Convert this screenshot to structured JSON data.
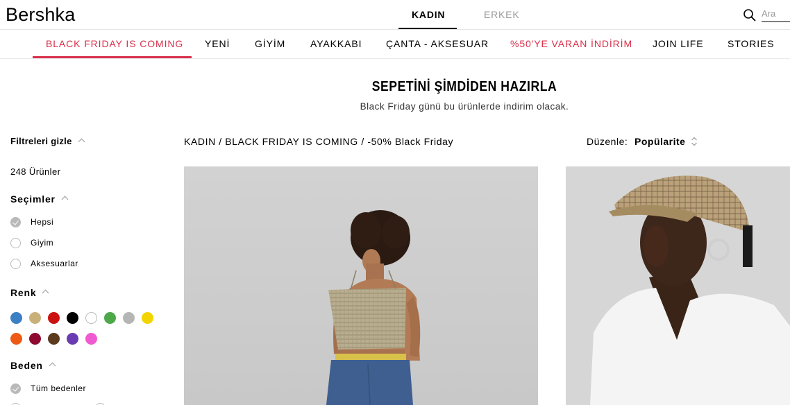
{
  "header": {
    "logo": "Bershka",
    "gender_tabs": [
      {
        "label": "KADIN",
        "active": true
      },
      {
        "label": "ERKEK",
        "active": false
      }
    ],
    "search": {
      "placeholder": "Ara",
      "icon": "search-icon"
    }
  },
  "nav": {
    "items": [
      {
        "label": "BLACK FRIDAY IS COMING",
        "highlight": true,
        "active": true
      },
      {
        "label": "YENİ"
      },
      {
        "label": "GİYİM"
      },
      {
        "label": "AYAKKABI"
      },
      {
        "label": "ÇANTA - AKSESUAR"
      },
      {
        "label": "%50'YE VARAN İNDİRİM",
        "highlight": true
      },
      {
        "label": "JOIN LIFE"
      },
      {
        "label": "STORIES"
      }
    ],
    "highlight_color": "#d9304a"
  },
  "hero": {
    "title": "SEPETİNİ ŞİMDİDEN HAZIRLA",
    "subtitle": "Black Friday günü bu ürünlerde indirim olacak."
  },
  "sidebar": {
    "filter_toggle": "Filtreleri gizle",
    "product_count": "248 Ürünler",
    "selections": {
      "title": "Seçimler",
      "options": [
        {
          "label": "Hepsi",
          "checked": true
        },
        {
          "label": "Giyim",
          "checked": false
        },
        {
          "label": "Aksesuarlar",
          "checked": false
        }
      ]
    },
    "color": {
      "title": "Renk",
      "swatches": [
        {
          "name": "blue",
          "hex": "#3b7fc4"
        },
        {
          "name": "beige",
          "hex": "#c9b07a"
        },
        {
          "name": "red",
          "hex": "#cc1111"
        },
        {
          "name": "black",
          "hex": "#000000"
        },
        {
          "name": "white",
          "hex": "#ffffff"
        },
        {
          "name": "green",
          "hex": "#4da84a"
        },
        {
          "name": "grey",
          "hex": "#b5b5b5"
        },
        {
          "name": "yellow",
          "hex": "#f2d500"
        },
        {
          "name": "orange",
          "hex": "#ee5a14"
        },
        {
          "name": "burgundy",
          "hex": "#8e0a30"
        },
        {
          "name": "brown",
          "hex": "#5c3a1e"
        },
        {
          "name": "purple",
          "hex": "#6a3bb2"
        },
        {
          "name": "pink",
          "hex": "#f05ad0"
        }
      ]
    },
    "size": {
      "title": "Beden",
      "options": [
        {
          "label": "Tüm bedenler",
          "checked": true
        }
      ]
    }
  },
  "listing": {
    "breadcrumb": "KADIN / BLACK FRIDAY IS COMING / -50% Black Friday",
    "sort_label": "Düzenle:",
    "sort_value": "Popülarite"
  }
}
